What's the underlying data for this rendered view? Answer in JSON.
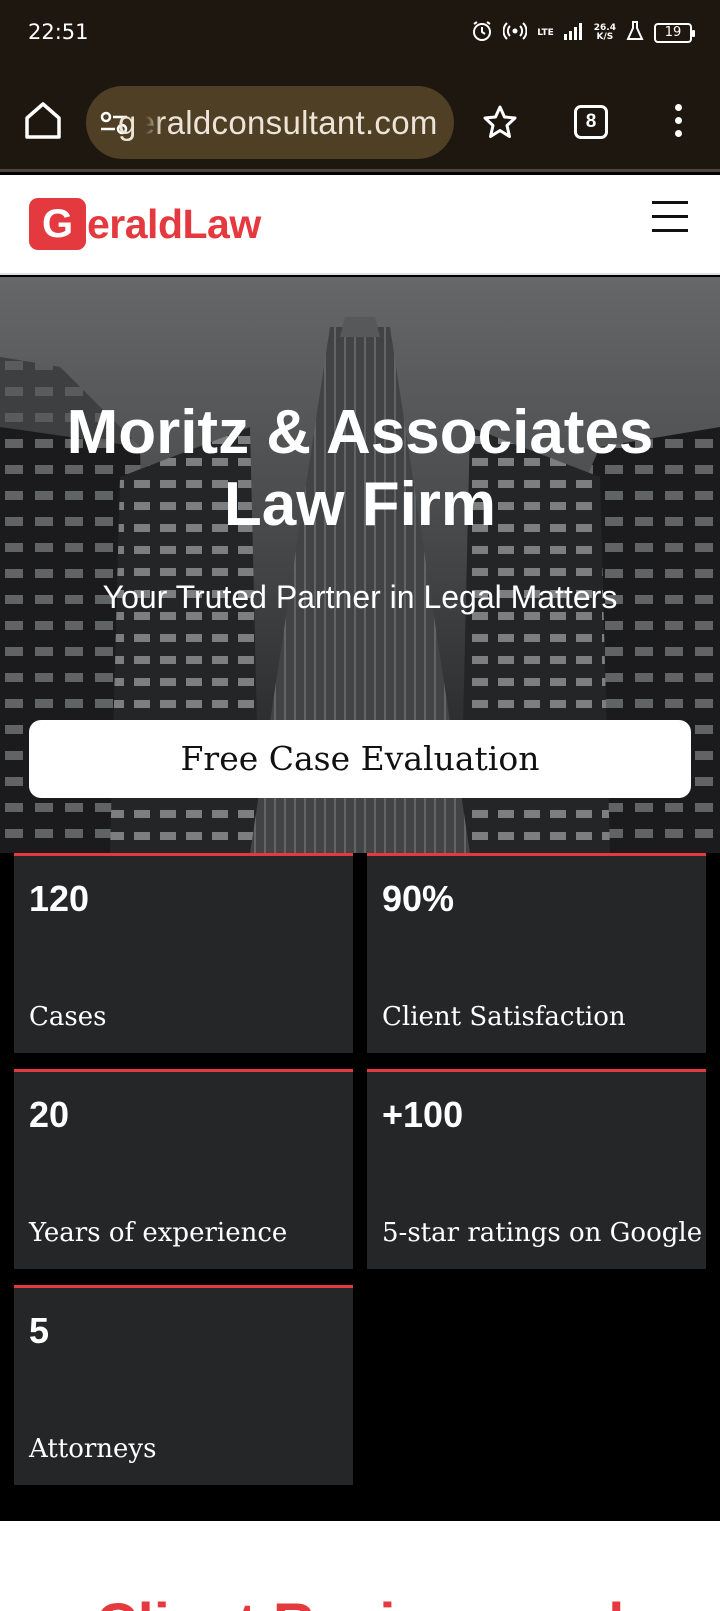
{
  "status_bar": {
    "time": "22:51",
    "network": "LTE",
    "speed_value": "26.4",
    "speed_unit": "K/S",
    "battery": "19"
  },
  "browser": {
    "url": "geraldconsultant.com",
    "tab_count": "8"
  },
  "site": {
    "logo_letter": "G",
    "logo_text": "eraldLaw",
    "brand_color": "#e4393f"
  },
  "hero": {
    "title_line1": "Moritz & Associates",
    "title_line2": "Law Firm",
    "subtitle": "Your Truted Partner in Legal Matters",
    "cta_label": "Free Case Evaluation"
  },
  "stats": [
    {
      "value": "120",
      "label": "Cases"
    },
    {
      "value": "90%",
      "label": "Client Satisfaction"
    },
    {
      "value": "20",
      "label": "Years of experience"
    },
    {
      "value": "+100",
      "label": "5-star ratings on Google"
    },
    {
      "value": "5",
      "label": "Attorneys"
    }
  ],
  "reviews": {
    "title": "Client Reviews and"
  }
}
